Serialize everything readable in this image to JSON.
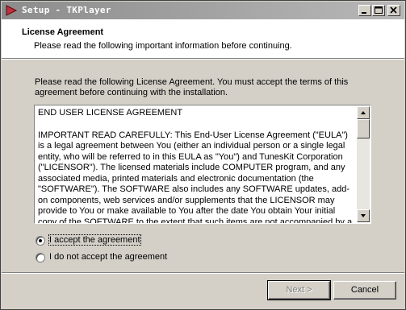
{
  "window": {
    "title": "Setup - TKPlayer"
  },
  "header": {
    "title": "License Agreement",
    "subtitle": "Please read the following important information before continuing."
  },
  "intro": "Please read the following License Agreement. You must accept the terms of this agreement before continuing with the installation.",
  "eula": {
    "heading": "END USER LICENSE AGREEMENT",
    "body": "IMPORTANT READ CAREFULLY: This End-User License Agreement (\"EULA\") is a legal agreement between You (either an individual person or a single legal entity, who will be referred to in this EULA as \"You\") and TunesKit Corporation (\"LICENSOR\"). The licensed materials include COMPUTER program, and any associated media, printed materials and electronic documentation (the \"SOFTWARE\"). The SOFTWARE also includes any SOFTWARE updates, add-on components, web services and/or supplements that the LICENSOR may provide to You or make available to You after the date You obtain Your initial copy of the SOFTWARE to the extent that such items are not accompanied by a separate"
  },
  "options": {
    "accept": "I accept the agreement",
    "decline": "I do not accept the agreement",
    "selected": "accept"
  },
  "buttons": {
    "next": "Next >",
    "cancel": "Cancel"
  },
  "colors": {
    "titlebar": "#8c8c8c",
    "window": "#d4d0c8",
    "icon_accent": "#c0303a"
  }
}
